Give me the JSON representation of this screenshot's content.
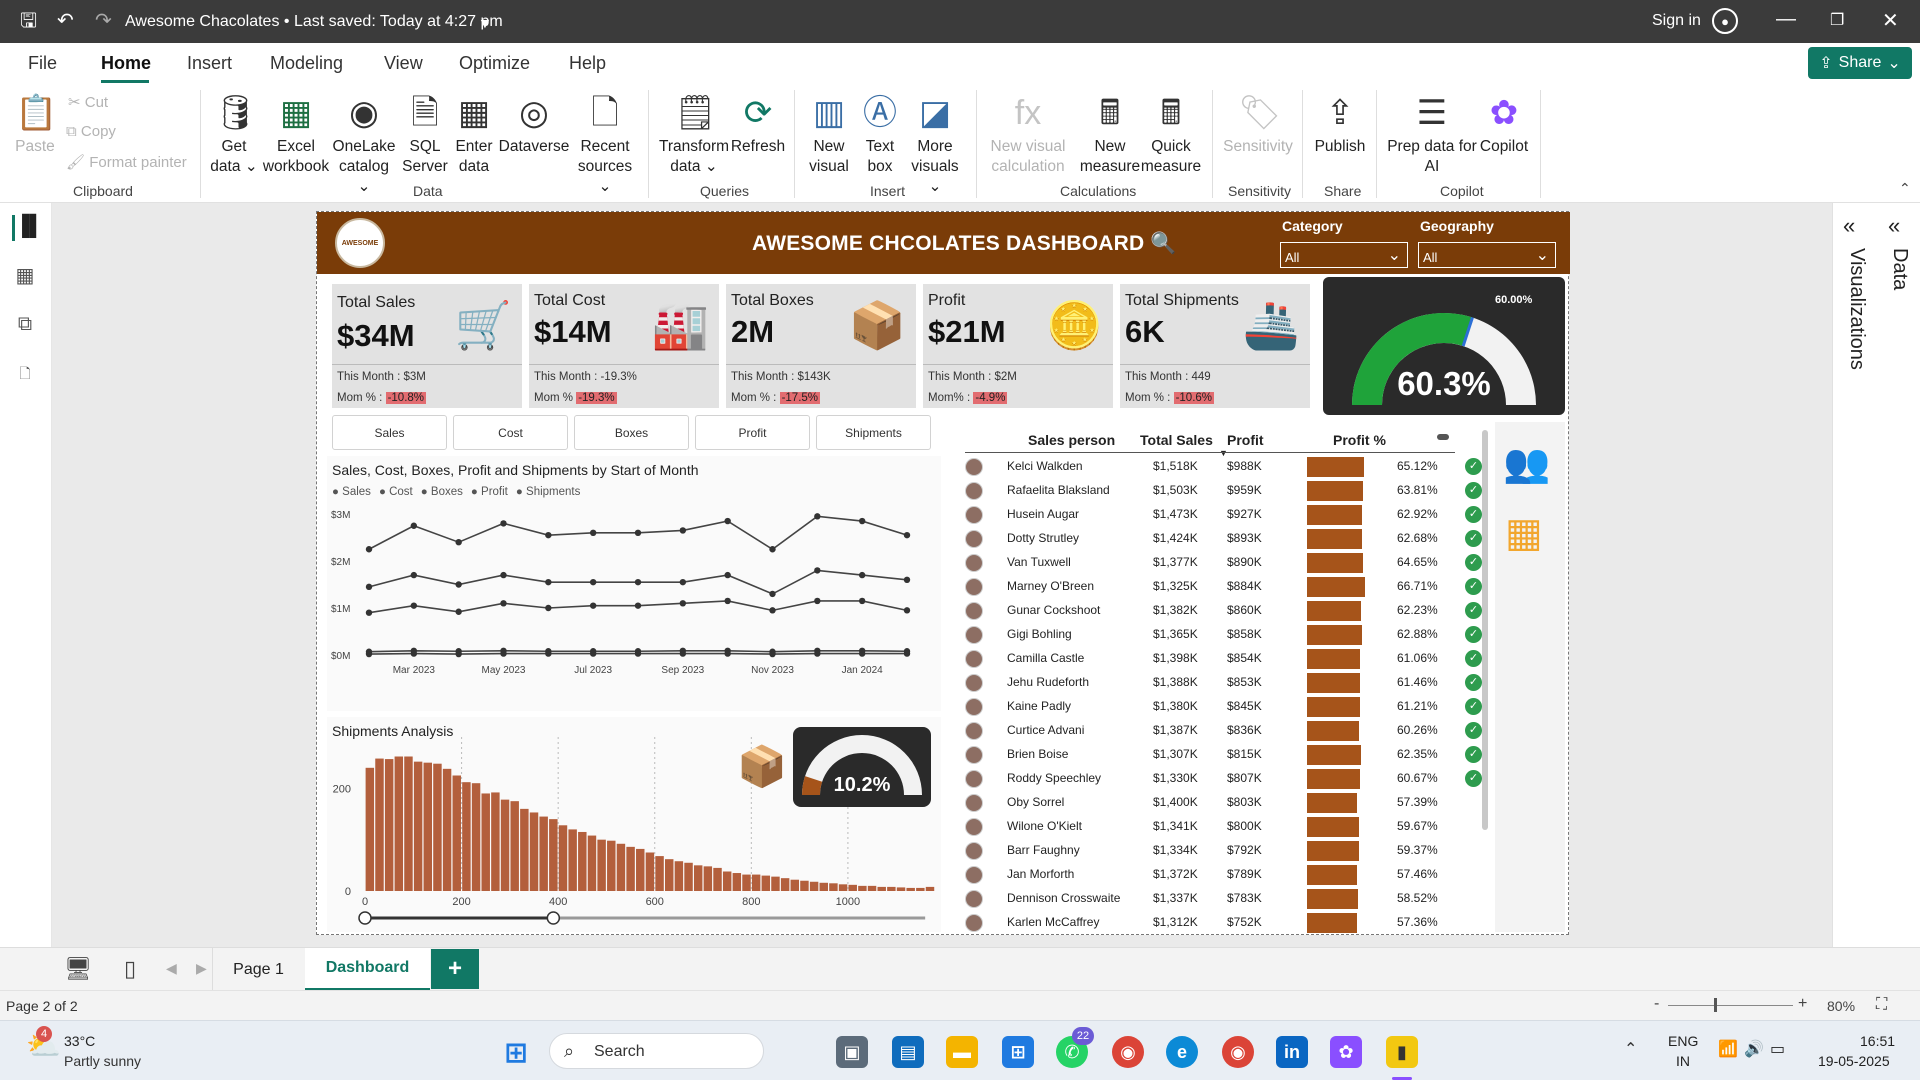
{
  "app": {
    "title": "Awesome Chacolates • Last saved: Today at 4:27 pm",
    "sign_in": "Sign in",
    "share": "Share"
  },
  "menu": [
    "File",
    "Home",
    "Insert",
    "Modeling",
    "View",
    "Optimize",
    "Help"
  ],
  "ribbon": {
    "clipboard": {
      "paste": "Paste",
      "cut": "Cut",
      "copy": "Copy",
      "format_painter": "Format painter",
      "label": "Clipboard"
    },
    "data": {
      "get_data": "Get data",
      "excel": "Excel workbook",
      "onelake": "OneLake catalog",
      "sql": "SQL Server",
      "enter": "Enter data",
      "dataverse": "Dataverse",
      "recent": "Recent sources",
      "label": "Data"
    },
    "queries": {
      "transform": "Transform data",
      "refresh": "Refresh",
      "label": "Queries"
    },
    "insert": {
      "new_visual": "New visual",
      "text_box": "Text box",
      "more_visuals": "More visuals",
      "label": "Insert"
    },
    "calculations": {
      "new_visual_calc": "New visual calculation",
      "new_measure": "New measure",
      "quick_measure": "Quick measure",
      "label": "Calculations"
    },
    "sensitivity": {
      "sensitivity": "Sensitivity",
      "label": "Sensitivity"
    },
    "share": {
      "publish": "Publish",
      "label": "Share"
    },
    "copilot": {
      "prep": "Prep data for AI",
      "copilot": "Copilot",
      "label": "Copilot"
    }
  },
  "panes": {
    "visualizations": "Visualizations",
    "data": "Data"
  },
  "dashboard": {
    "title": "AWESOME CHCOLATES DASHBOARD 🔍",
    "logo_text": "AWESOME",
    "category_label": "Category",
    "category_value": "All",
    "geography_label": "Geography",
    "geography_value": "All",
    "kpis": [
      {
        "title": "Total Sales",
        "value": "$34M",
        "sub1": "This Month : $3M",
        "sub2_label": "Mom % :",
        "sub2_value": "-10.8%",
        "icon": "cart-icon"
      },
      {
        "title": "Total Cost",
        "value": "$14M",
        "sub1": "This Month : -19.3%",
        "sub2_label": "Mom %",
        "sub2_value": "-19.3%",
        "icon": "factory-icon"
      },
      {
        "title": "Total Boxes",
        "value": "2M",
        "sub1": "This Month : $143K",
        "sub2_label": "Mom % :",
        "sub2_value": "-17.5%",
        "icon": "box-icon"
      },
      {
        "title": "Profit",
        "value": "$21M",
        "sub1": "This Month : $2M",
        "sub2_label": "Mom% :",
        "sub2_value": "-4.9%",
        "icon": "coins-icon"
      },
      {
        "title": "Total Shipments",
        "value": "6K",
        "sub1": "This Month : 449",
        "sub2_label": "Mom % :",
        "sub2_value": "-10.6%",
        "icon": "ship-icon"
      }
    ],
    "gauge_big": {
      "label": "60.00%",
      "value": "60.3%",
      "fraction": 0.603
    },
    "tabs": [
      "Sales",
      "Cost",
      "Boxes",
      "Profit",
      "Shipments"
    ],
    "line_chart_title": "Sales, Cost, Boxes, Profit and Shipments by Start of Month",
    "legend": [
      "Sales",
      "Cost",
      "Boxes",
      "Profit",
      "Shipments"
    ],
    "shipments_title": "Shipments Analysis",
    "gauge_small": {
      "value": "10.2%",
      "fraction": 0.102
    },
    "table_headers": [
      "Sales person",
      "Total Sales",
      "Profit",
      "Profit %"
    ],
    "rows": [
      {
        "name": "Kelci Walkden",
        "sales": "$1,518K",
        "profit": "$988K",
        "pct": "65.12%",
        "ok": true,
        "bar": 0.98
      },
      {
        "name": "Rafaelita Blaksland",
        "sales": "$1,503K",
        "profit": "$959K",
        "pct": "63.81%",
        "ok": true,
        "bar": 0.96
      },
      {
        "name": "Husein Augar",
        "sales": "$1,473K",
        "profit": "$927K",
        "pct": "62.92%",
        "ok": true,
        "bar": 0.94
      },
      {
        "name": "Dotty Strutley",
        "sales": "$1,424K",
        "profit": "$893K",
        "pct": "62.68%",
        "ok": true,
        "bar": 0.94
      },
      {
        "name": "Van Tuxwell",
        "sales": "$1,377K",
        "profit": "$890K",
        "pct": "64.65%",
        "ok": true,
        "bar": 0.97
      },
      {
        "name": "Marney O'Breen",
        "sales": "$1,325K",
        "profit": "$884K",
        "pct": "66.71%",
        "ok": true,
        "bar": 1.0
      },
      {
        "name": "Gunar Cockshoot",
        "sales": "$1,382K",
        "profit": "$860K",
        "pct": "62.23%",
        "ok": true,
        "bar": 0.93
      },
      {
        "name": "Gigi Bohling",
        "sales": "$1,365K",
        "profit": "$858K",
        "pct": "62.88%",
        "ok": true,
        "bar": 0.94
      },
      {
        "name": "Camilla Castle",
        "sales": "$1,398K",
        "profit": "$854K",
        "pct": "61.06%",
        "ok": true,
        "bar": 0.92
      },
      {
        "name": "Jehu Rudeforth",
        "sales": "$1,388K",
        "profit": "$853K",
        "pct": "61.46%",
        "ok": true,
        "bar": 0.92
      },
      {
        "name": "Kaine Padly",
        "sales": "$1,380K",
        "profit": "$845K",
        "pct": "61.21%",
        "ok": true,
        "bar": 0.92
      },
      {
        "name": "Curtice Advani",
        "sales": "$1,387K",
        "profit": "$836K",
        "pct": "60.26%",
        "ok": true,
        "bar": 0.9
      },
      {
        "name": "Brien Boise",
        "sales": "$1,307K",
        "profit": "$815K",
        "pct": "62.35%",
        "ok": true,
        "bar": 0.93
      },
      {
        "name": "Roddy Speechley",
        "sales": "$1,330K",
        "profit": "$807K",
        "pct": "60.67%",
        "ok": true,
        "bar": 0.91
      },
      {
        "name": "Oby Sorrel",
        "sales": "$1,400K",
        "profit": "$803K",
        "pct": "57.39%",
        "ok": false,
        "bar": 0.86
      },
      {
        "name": "Wilone O'Kielt",
        "sales": "$1,341K",
        "profit": "$800K",
        "pct": "59.67%",
        "ok": false,
        "bar": 0.89
      },
      {
        "name": "Barr Faughny",
        "sales": "$1,334K",
        "profit": "$792K",
        "pct": "59.37%",
        "ok": false,
        "bar": 0.89
      },
      {
        "name": "Jan Morforth",
        "sales": "$1,372K",
        "profit": "$789K",
        "pct": "57.46%",
        "ok": false,
        "bar": 0.86
      },
      {
        "name": "Dennison Crosswaite",
        "sales": "$1,337K",
        "profit": "$783K",
        "pct": "58.52%",
        "ok": false,
        "bar": 0.88
      },
      {
        "name": "Karlen McCaffrey",
        "sales": "$1,312K",
        "profit": "$752K",
        "pct": "57.36%",
        "ok": false,
        "bar": 0.86
      }
    ]
  },
  "pages": {
    "page1": "Page 1",
    "dashboard": "Dashboard",
    "add": "+"
  },
  "status": {
    "page": "Page 2 of 2",
    "zoom": "80%"
  },
  "taskbar": {
    "weather_temp": "33°C",
    "weather_desc": "Partly sunny",
    "weather_badge": "4",
    "search": "Search",
    "whatsapp_badge": "22",
    "lang1": "ENG",
    "lang2": "IN",
    "time": "16:51",
    "date": "19-05-2025"
  },
  "chart_data": [
    {
      "type": "line",
      "title": "Sales, Cost, Boxes, Profit and Shipments by Start of Month",
      "x": [
        "Feb 2023",
        "Mar 2023",
        "Apr 2023",
        "May 2023",
        "Jun 2023",
        "Jul 2023",
        "Aug 2023",
        "Sep 2023",
        "Oct 2023",
        "Nov 2023",
        "Dec 2023",
        "Jan 2024",
        "Feb 2024"
      ],
      "x_tick_labels": [
        "Mar 2023",
        "May 2023",
        "Jul 2023",
        "Sep 2023",
        "Nov 2023",
        "Jan 2024"
      ],
      "y_tick_labels": [
        "$0M",
        "$1M",
        "$2M",
        "$3M"
      ],
      "ylim": [
        0,
        3
      ],
      "series": [
        {
          "name": "Sales",
          "values": [
            2.25,
            2.75,
            2.4,
            2.8,
            2.55,
            2.6,
            2.6,
            2.65,
            2.85,
            2.25,
            2.95,
            2.85,
            2.55
          ]
        },
        {
          "name": "Cost",
          "values": [
            1.45,
            1.7,
            1.5,
            1.7,
            1.55,
            1.55,
            1.55,
            1.55,
            1.7,
            1.3,
            1.8,
            1.7,
            1.6
          ]
        },
        {
          "name": "Boxes",
          "values": [
            0.07,
            0.09,
            0.08,
            0.09,
            0.08,
            0.08,
            0.08,
            0.09,
            0.09,
            0.07,
            0.09,
            0.09,
            0.08
          ]
        },
        {
          "name": "Profit",
          "values": [
            0.9,
            1.05,
            0.92,
            1.1,
            1.0,
            1.05,
            1.05,
            1.1,
            1.15,
            0.95,
            1.15,
            1.15,
            0.95
          ]
        },
        {
          "name": "Shipments",
          "values": [
            0.02,
            0.03,
            0.02,
            0.03,
            0.03,
            0.03,
            0.03,
            0.03,
            0.03,
            0.02,
            0.03,
            0.03,
            0.03
          ]
        }
      ]
    },
    {
      "type": "bar",
      "title": "Shipments Analysis",
      "x_tick_labels": [
        "0",
        "200",
        "400",
        "600",
        "800",
        "1000"
      ],
      "y_tick_labels": [
        "0",
        "200"
      ],
      "xlim": [
        0,
        1170
      ],
      "ylim": [
        0,
        300
      ],
      "bin_width": 20,
      "values": [
        240,
        258,
        257,
        262,
        262,
        252,
        250,
        248,
        238,
        225,
        212,
        210,
        190,
        192,
        178,
        175,
        160,
        153,
        145,
        140,
        128,
        120,
        115,
        108,
        100,
        98,
        92,
        86,
        82,
        75,
        68,
        62,
        58,
        55,
        50,
        48,
        45,
        38,
        35,
        32,
        32,
        30,
        28,
        25,
        22,
        20,
        18,
        16,
        15,
        13,
        12,
        10,
        10,
        8,
        8,
        7,
        6,
        6,
        8
      ]
    }
  ]
}
